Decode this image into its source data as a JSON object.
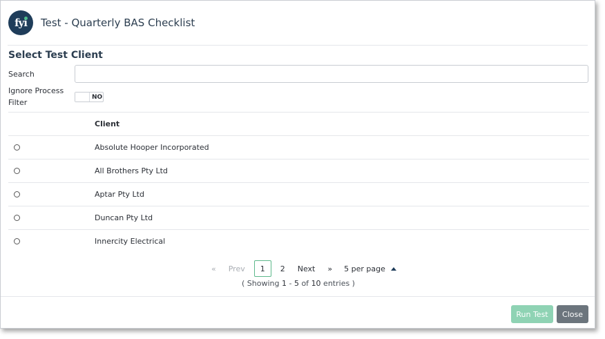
{
  "header": {
    "logo_text": "fyi",
    "title": "Test - Quarterly BAS Checklist"
  },
  "section_title": "Select Test Client",
  "search": {
    "label": "Search",
    "value": "",
    "placeholder": ""
  },
  "ignore_filter": {
    "label_line1": "Ignore Process",
    "label_line2": "Filter",
    "state": "NO"
  },
  "table": {
    "column_header": "Client",
    "rows": [
      "Absolute Hooper Incorporated",
      "All Brothers Pty Ltd",
      "Aptar Pty Ltd",
      "Duncan Pty Ltd",
      "Innercity Electrical"
    ]
  },
  "pagination": {
    "first": "«",
    "prev": "Prev",
    "pages": [
      "1",
      "2"
    ],
    "current": "1",
    "next": "Next",
    "last": "»",
    "per_page": "5 per page",
    "showing_prefix": "( Showing ",
    "range_start": "1",
    "range_sep": " - ",
    "range_end": "5",
    "of_text": " of ",
    "total": "10",
    "entries_suffix": " entries )"
  },
  "footer": {
    "run_label": "Run Test",
    "close_label": "Close"
  },
  "colors": {
    "brand": "#1f3d5a",
    "accent": "#5cb88a",
    "run_button": "#8fd3b4",
    "close_button": "#6c757d"
  }
}
